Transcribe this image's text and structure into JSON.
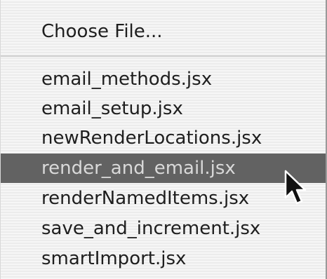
{
  "menu": {
    "choose_item": "Choose File...",
    "scripts": [
      "email_methods.jsx",
      "email_setup.jsx",
      "newRenderLocations.jsx",
      "render_and_email.jsx",
      "renderNamedItems.jsx",
      "save_and_increment.jsx",
      "smartImport.jsx"
    ],
    "selected_item": "render_and_email.jsx"
  },
  "icons": {
    "cursor": "arrow-pointer-icon"
  }
}
